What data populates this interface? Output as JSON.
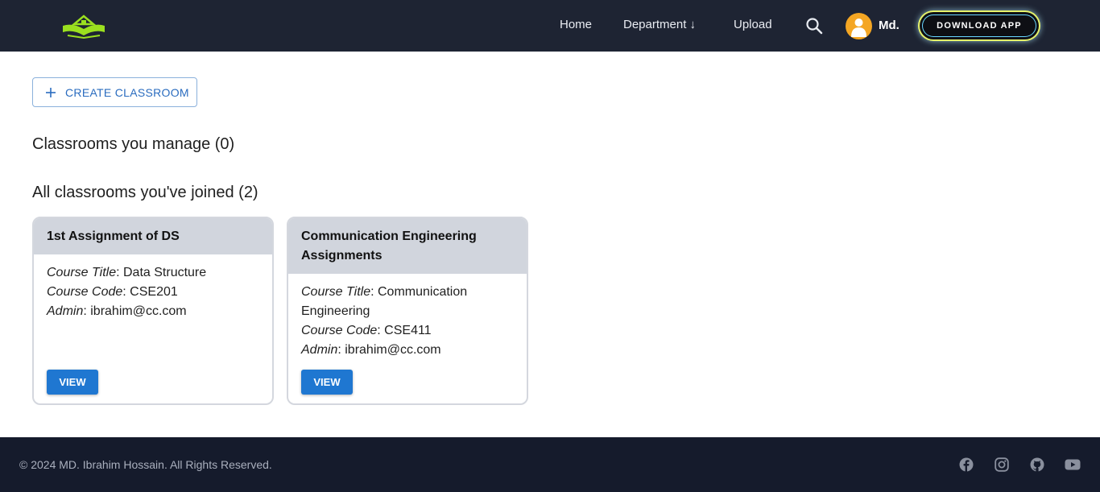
{
  "header": {
    "nav": {
      "home": "Home",
      "department": "Department ↓",
      "upload": "Upload"
    },
    "user_name": "Md.",
    "download_label": "DOWNLOAD APP"
  },
  "main": {
    "create_label": "CREATE CLASSROOM",
    "manage_title": "Classrooms you manage (0)",
    "joined_title": "All classrooms you've joined (2)",
    "classrooms": [
      {
        "name": "1st Assignment of DS",
        "course_title_label": "Course Title",
        "course_title": ": Data Structure",
        "course_code_label": "Course Code",
        "course_code": ": CSE201",
        "admin_label": "Admin",
        "admin": ": ibrahim@cc.com",
        "view_label": "VIEW"
      },
      {
        "name": "Communication Engineering Assignments",
        "course_title_label": "Course Title",
        "course_title": ": Communication Engineering",
        "course_code_label": "Course Code",
        "course_code": ": CSE411",
        "admin_label": "Admin",
        "admin": ": ibrahim@cc.com",
        "view_label": "VIEW"
      }
    ]
  },
  "footer": {
    "copyright": "© 2024 MD. Ibrahim Hossain. All Rights Reserved.",
    "social_icons": [
      "facebook-icon",
      "instagram-icon",
      "github-icon",
      "youtube-icon"
    ]
  },
  "colors": {
    "header_bg": "#1e2433",
    "footer_bg": "#151b2c",
    "accent_blue": "#1f77d1",
    "logo_green": "#9be01f"
  }
}
